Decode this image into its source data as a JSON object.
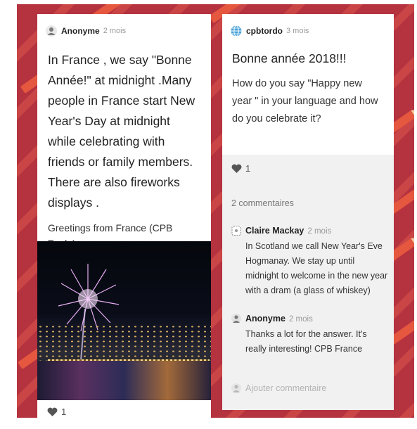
{
  "colors": {
    "board_background": "#b5323f",
    "card": "#ffffff",
    "comments_panel": "#f1f1f1",
    "heart": "#555555"
  },
  "post1": {
    "avatar_icon": "person-icon",
    "author": "Anonyme",
    "time": "2 mois",
    "text": "In France , we say \"Bonne Année!\" at midnight .Many people in France start New Year's Day at midnight while celebrating with friends or family members. There are also fireworks displays .",
    "footnote": "Greetings from France (CPB Tordo)",
    "likes": "1"
  },
  "post2": {
    "avatar_icon": "globe-icon",
    "author": "cpbtordo",
    "time": "3 mois",
    "title": "Bonne année 2018!!!",
    "text": "How do you say \"Happy new year \" in your language and how do you celebrate it?",
    "likes": "1",
    "comments_count": "2 commentaires",
    "comments": [
      {
        "author": "Claire Mackay",
        "time": "2 mois",
        "text": "In Scotland we call New Year's Eve Hogmanay. We stay up until midnight to welcome in the new year with a dram (a glass of whiskey)"
      },
      {
        "author": "Anonyme",
        "time": "2 mois",
        "text": "Thanks a lot for the answer. It's really interesting! CPB France"
      }
    ],
    "add_comment_placeholder": "Ajouter commentaire"
  }
}
